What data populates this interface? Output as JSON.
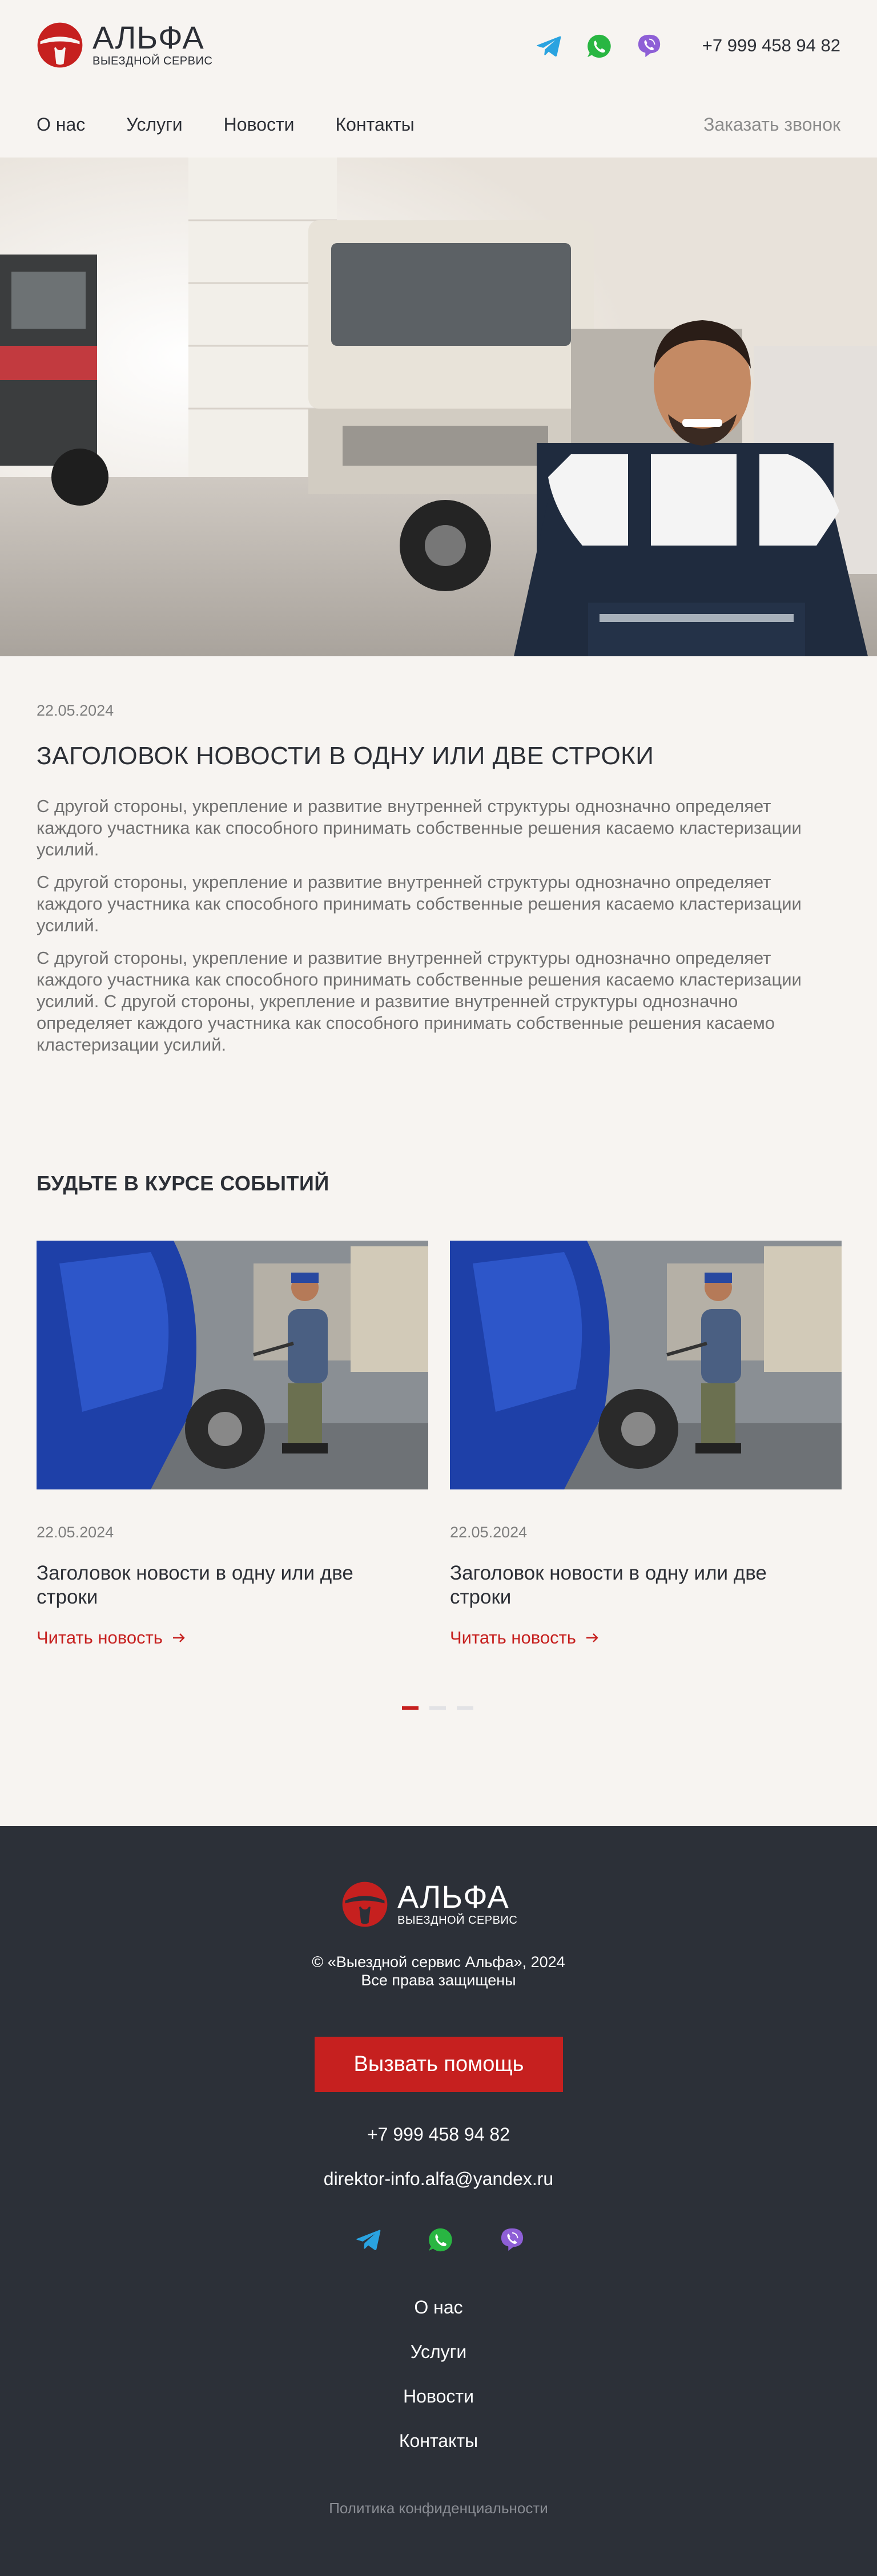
{
  "brand": {
    "name": "АЛЬФА",
    "tagline": "ВЫЕЗДНОЙ СЕРВИС",
    "accent": "#c6201f"
  },
  "header": {
    "phone": "+7 999 458 94 82",
    "messengers": [
      "telegram-icon",
      "whatsapp-icon",
      "viber-icon"
    ],
    "nav": [
      "О нас",
      "Услуги",
      "Новости",
      "Контакты"
    ],
    "callback": "Заказать звонок"
  },
  "article": {
    "date": "22.05.2024",
    "title": "ЗАГОЛОВОК НОВОСТИ В ОДНУ ИЛИ ДВЕ СТРОКИ",
    "paragraphs": [
      "С другой стороны, укрепление и развитие внутренней структуры однозначно определяет каждого участника как способного принимать собственные решения касаемо кластеризации усилий.",
      "С другой стороны, укрепление и развитие внутренней структуры однозначно определяет каждого участника как способного принимать собственные решения касаемо кластеризации усилий.",
      "С другой стороны, укрепление и развитие внутренней структуры однозначно определяет каждого участника как способного принимать собственные решения касаемо кластеризации усилий. С другой стороны, укрепление и развитие внутренней структуры однозначно определяет каждого участника как способного принимать собственные решения касаемо кластеризации усилий."
    ]
  },
  "news": {
    "heading": "БУДЬТЕ В КУРСЕ СОБЫТИЙ",
    "cards": [
      {
        "date": "22.05.2024",
        "title": "Заголовок новости в одну или две строки",
        "link": "Читать новость"
      },
      {
        "date": "22.05.2024",
        "title": "Заголовок новости в одну или две строки",
        "link": "Читать новость"
      }
    ],
    "pagination": {
      "total": 3,
      "active": 1
    }
  },
  "footer": {
    "copyright_line1": "© «Выездной сервис Альфа», 2024",
    "copyright_line2": "Все права защищены",
    "cta": "Вызвать помощь",
    "phone": "+7 999 458 94 82",
    "email": "direktor-info.alfa@yandex.ru",
    "nav": [
      "О нас",
      "Услуги",
      "Новости",
      "Контакты"
    ],
    "policy": "Политика конфиденциальности"
  }
}
